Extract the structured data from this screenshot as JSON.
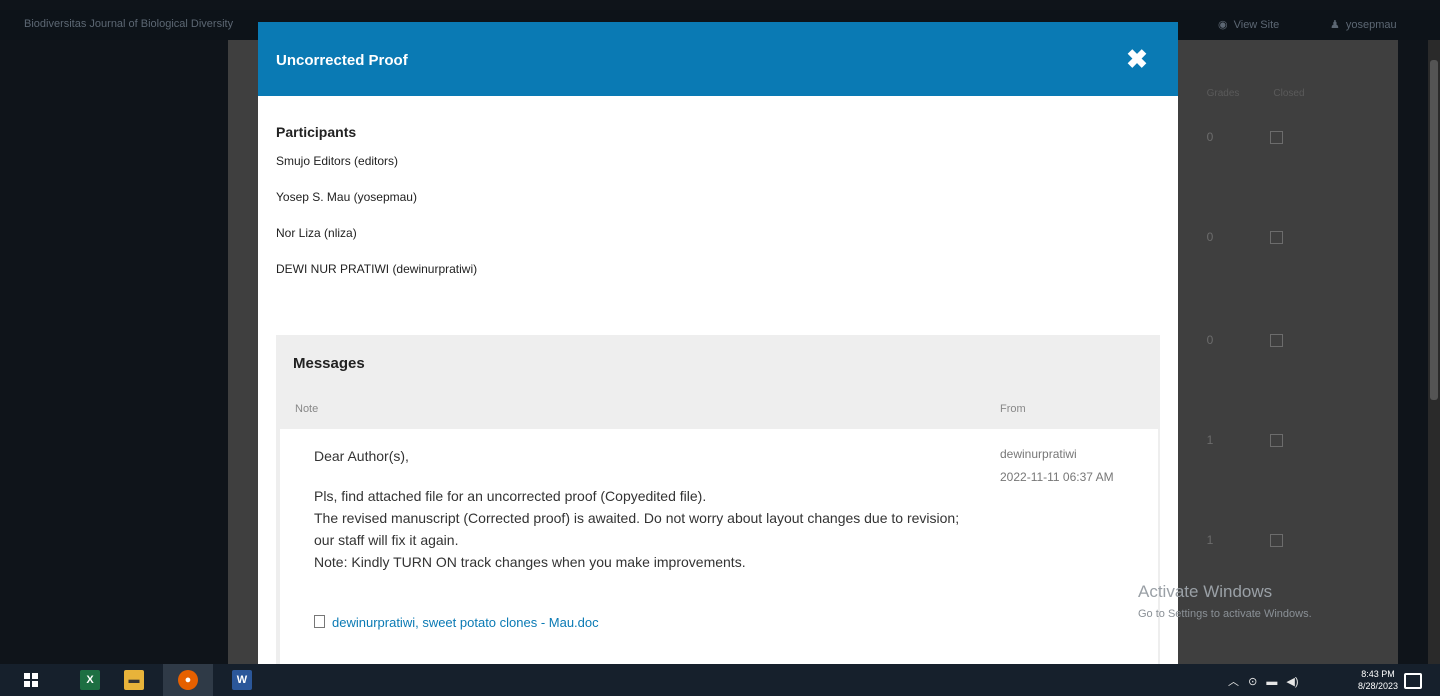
{
  "background": {
    "site_title": "Biodiversitas Journal of Biological Diversity",
    "view_site": "View Site",
    "user": "yosepmau",
    "columns": [
      "Grades",
      "Closed"
    ],
    "row_values": [
      "0",
      "0",
      "0",
      "1",
      "1"
    ]
  },
  "modal": {
    "title": "Uncorrected Proof",
    "close_label": "✖",
    "participants_heading": "Participants",
    "participants": [
      "Smujo Editors (editors)",
      "Yosep S. Mau (yosepmau)",
      "Nor Liza (nliza)",
      "DEWI NUR PRATIWI (dewinurpratiwi)"
    ],
    "messages_heading": "Messages",
    "col_note": "Note",
    "col_from": "From",
    "message": {
      "greeting": "Dear Author(s),",
      "lines": [
        "Pls, find attached file for an uncorrected proof (Copyedited file).",
        "The revised manuscript (Corrected proof) is awaited. Do not worry about layout changes due to revision; our staff will fix it again.",
        "Note: Kindly TURN ON track changes when you make improvements."
      ],
      "from_user": "dewinurpratiwi",
      "from_date": "2022-11-11 06:37 AM",
      "attachment": "dewinurpratiwi, sweet potato clones - Mau.doc"
    }
  },
  "watermark": {
    "line1": "Activate Windows",
    "line2": "Go to Settings to activate Windows."
  },
  "taskbar": {
    "time": "8:43 PM",
    "date": "8/28/2023"
  },
  "colors": {
    "header_blue": "#0a7ab4",
    "link_blue": "#0a7ab4",
    "taskbar": "#16202c"
  }
}
